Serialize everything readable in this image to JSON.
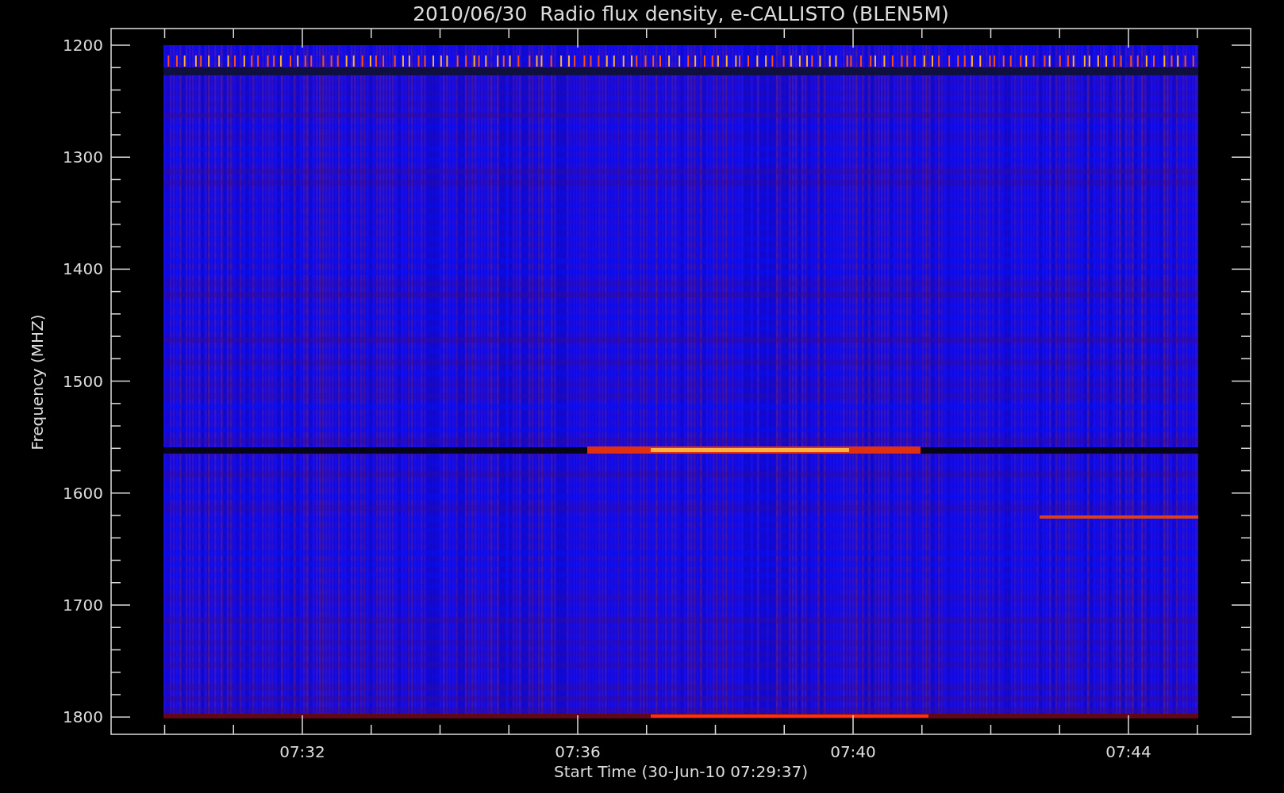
{
  "title": "2010/06/30  Radio flux density, e-CALLISTO (BLEN5M)",
  "y_axis": {
    "label": "Frequency (MHZ)",
    "ticks": [
      "1200",
      "1300",
      "1400",
      "1500",
      "1600",
      "1700",
      "1800"
    ]
  },
  "x_axis": {
    "label": "Start Time (30-Jun-10 07:29:37)",
    "ticks": [
      "07:32",
      "07:36",
      "07:40",
      "07:44"
    ]
  }
}
